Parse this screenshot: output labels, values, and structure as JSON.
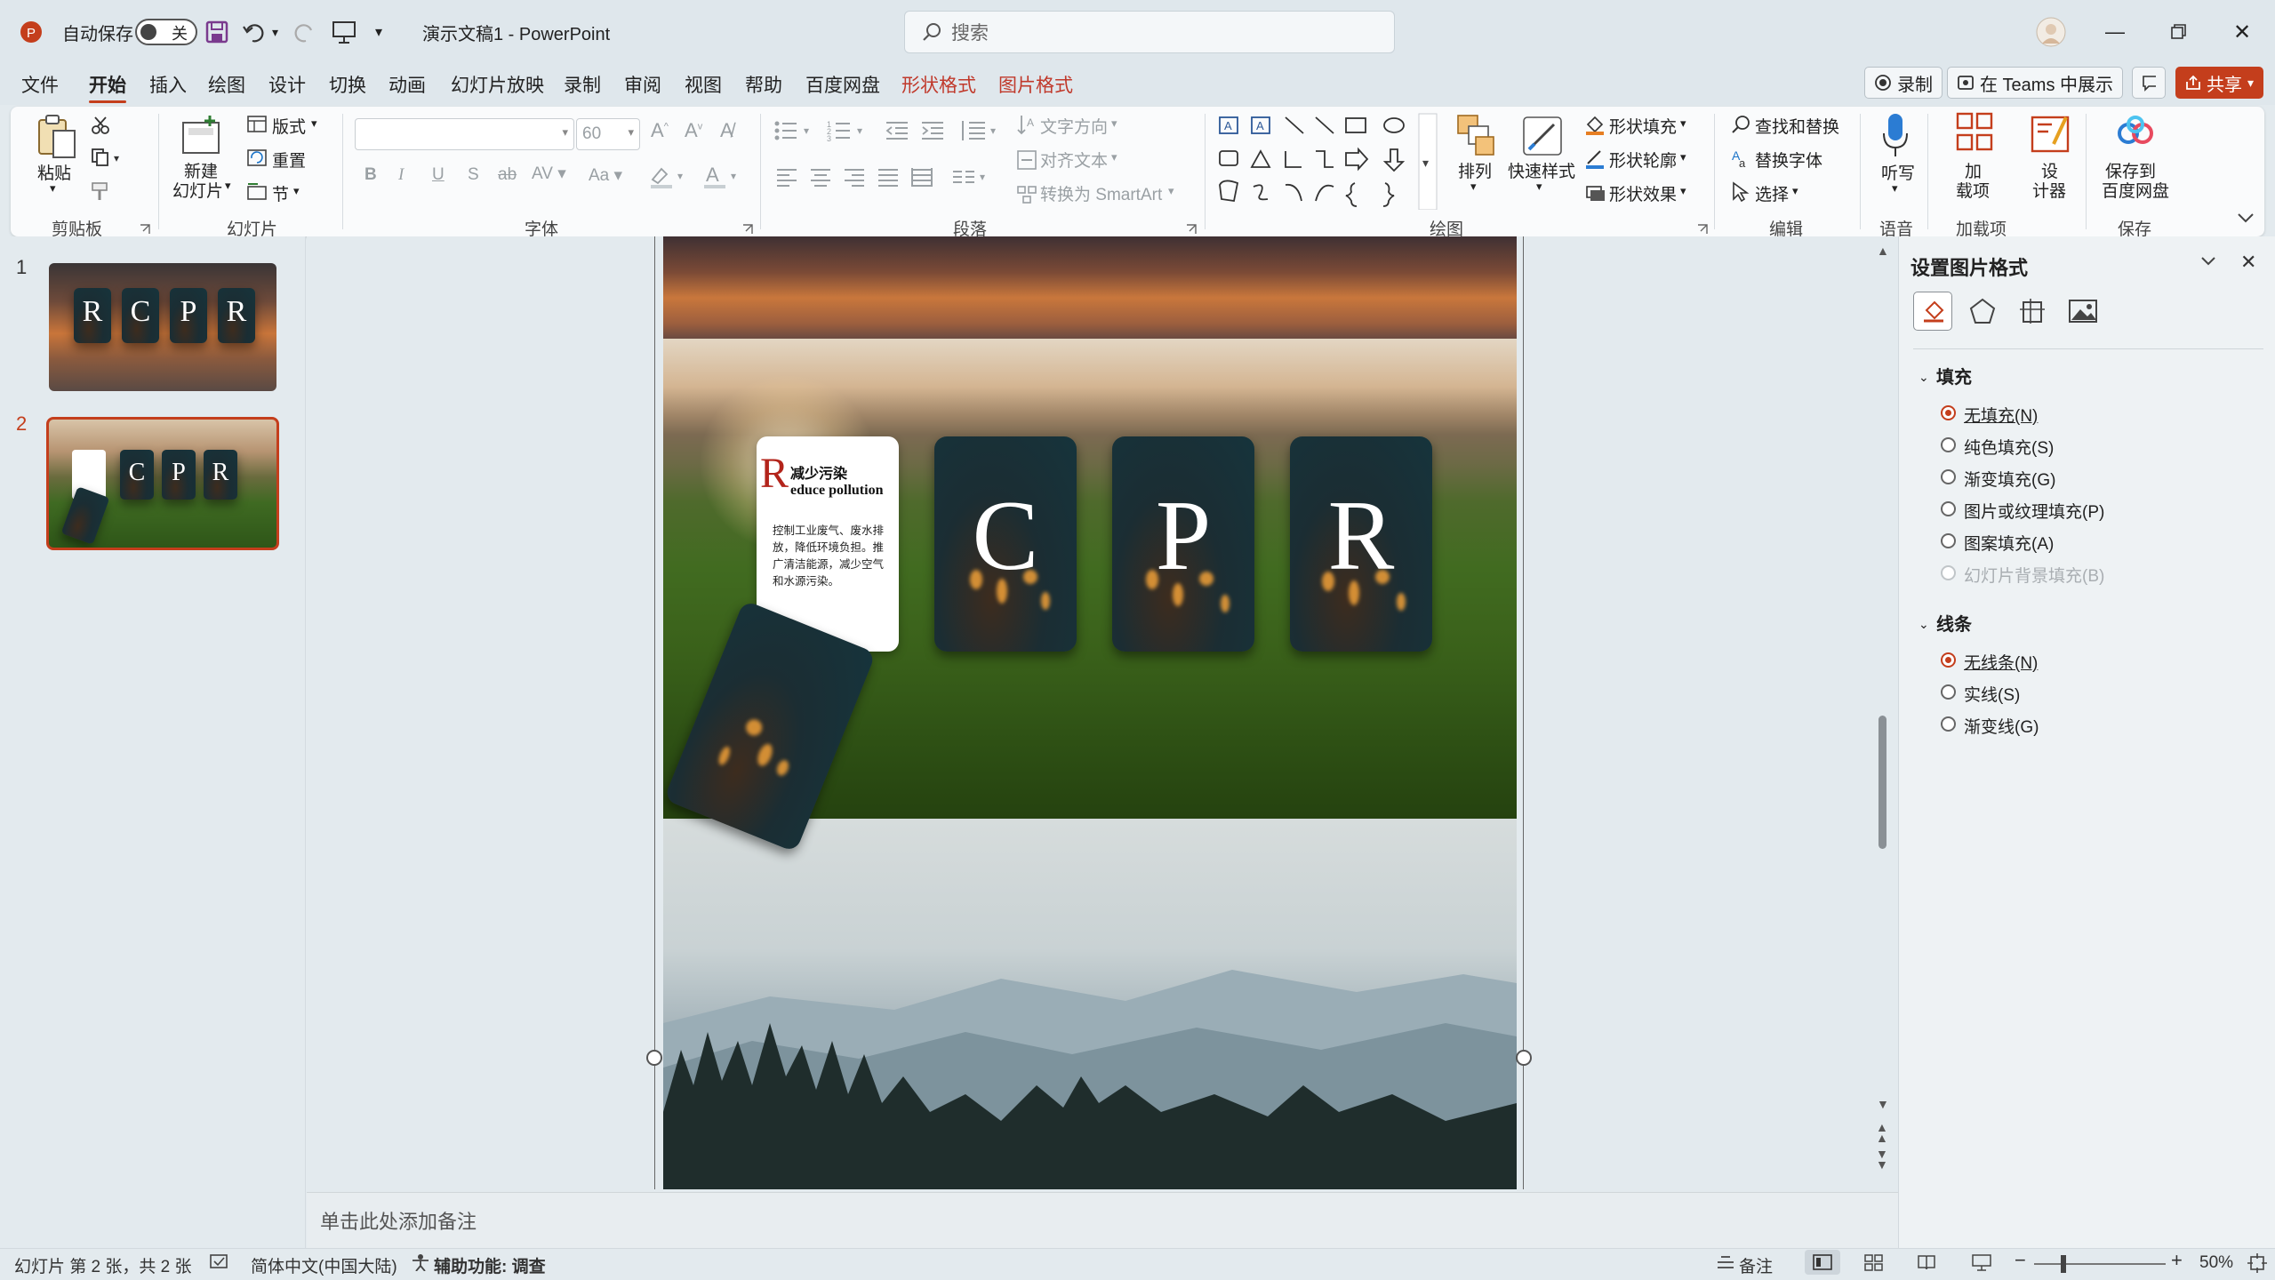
{
  "titlebar": {
    "autosave_label": "自动保存",
    "autosave_state": "关",
    "document_title": "演示文稿1  -  PowerPoint",
    "search_placeholder": "搜索"
  },
  "menu": {
    "tabs": [
      "文件",
      "开始",
      "插入",
      "绘图",
      "设计",
      "切换",
      "动画",
      "幻灯片放映",
      "录制",
      "审阅",
      "视图",
      "帮助",
      "百度网盘"
    ],
    "context_tabs": [
      "形状格式",
      "图片格式"
    ],
    "active_tab": "开始",
    "record_button": "录制",
    "teams_button": "在 Teams 中展示",
    "share_button": "共享"
  },
  "ribbon": {
    "clipboard": {
      "paste": "粘贴",
      "group": "剪贴板"
    },
    "slides": {
      "new_slide_line1": "新建",
      "new_slide_line2": "幻灯片",
      "layout": "版式",
      "reset": "重置",
      "section": "节",
      "group": "幻灯片"
    },
    "font": {
      "size": "60",
      "group": "字体"
    },
    "paragraph": {
      "text_direction": "文字方向",
      "align_text": "对齐文本",
      "smartart": "转换为 SmartArt",
      "group": "段落"
    },
    "drawing": {
      "arrange": "排列",
      "quick_styles": "快速样式",
      "shape_fill": "形状填充",
      "shape_outline": "形状轮廓",
      "shape_effects": "形状效果",
      "group": "绘图"
    },
    "editing": {
      "find_replace": "查找和替换",
      "replace_font": "替换字体",
      "select": "选择",
      "group": "编辑"
    },
    "voice": {
      "dictate": "听写",
      "group": "语音"
    },
    "addins": {
      "addins_line1": "加",
      "addins_line2": "载项",
      "designer_line1": "设",
      "designer_line2": "计器",
      "group": "加载项"
    },
    "save": {
      "save_baidu_line1": "保存到",
      "save_baidu_line2": "百度网盘",
      "group": "保存"
    }
  },
  "slides_panel": {
    "slide_numbers": [
      "1",
      "2"
    ],
    "selected": "2"
  },
  "slide": {
    "text_card": {
      "big_letter": "R",
      "title_cn": "减少污染",
      "title_en": "educe pollution",
      "body": "控制工业废气、废水排放，降低环境负担。推广清洁能源，减少空气和水源污染。"
    },
    "cards": [
      "C",
      "P",
      "R"
    ]
  },
  "notes_placeholder": "单击此处添加备注",
  "format_pane": {
    "title": "设置图片格式",
    "fill_section": "填充",
    "fill_options": [
      {
        "label": "无填充(N)",
        "selected": true,
        "disabled": false
      },
      {
        "label": "纯色填充(S)",
        "selected": false,
        "disabled": false
      },
      {
        "label": "渐变填充(G)",
        "selected": false,
        "disabled": false
      },
      {
        "label": "图片或纹理填充(P)",
        "selected": false,
        "disabled": false
      },
      {
        "label": "图案填充(A)",
        "selected": false,
        "disabled": false
      },
      {
        "label": "幻灯片背景填充(B)",
        "selected": false,
        "disabled": true
      }
    ],
    "line_section": "线条",
    "line_options": [
      {
        "label": "无线条(N)",
        "selected": true
      },
      {
        "label": "实线(S)",
        "selected": false
      },
      {
        "label": "渐变线(G)",
        "selected": false
      }
    ]
  },
  "statusbar": {
    "slide_info": "幻灯片 第 2 张，共 2 张",
    "language": "简体中文(中国大陆)",
    "accessibility": "辅助功能: 调查",
    "notes": "备注",
    "zoom": "50%"
  },
  "colors": {
    "accent": "#c43e1c",
    "ribbon_bg": "#fafbfc",
    "chrome_bg": "#e3eaee"
  }
}
